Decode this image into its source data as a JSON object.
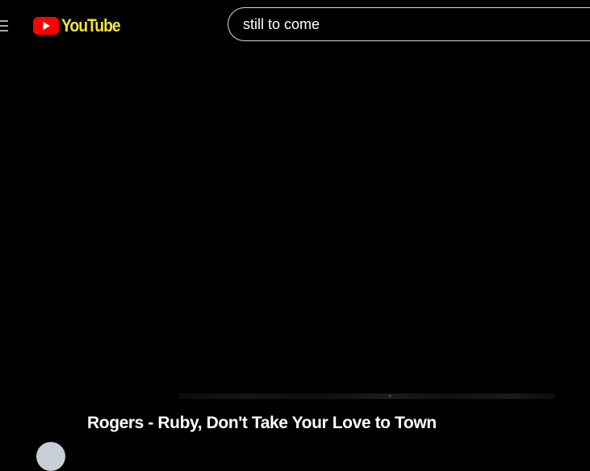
{
  "header": {
    "logo_text": "YouTube",
    "logo_colors": {
      "mark": "#ff0000",
      "text": "#f2e33b"
    }
  },
  "search": {
    "query": "still to come"
  },
  "video": {
    "title": "Rogers - Ruby, Don't Take Your Love to Town"
  }
}
